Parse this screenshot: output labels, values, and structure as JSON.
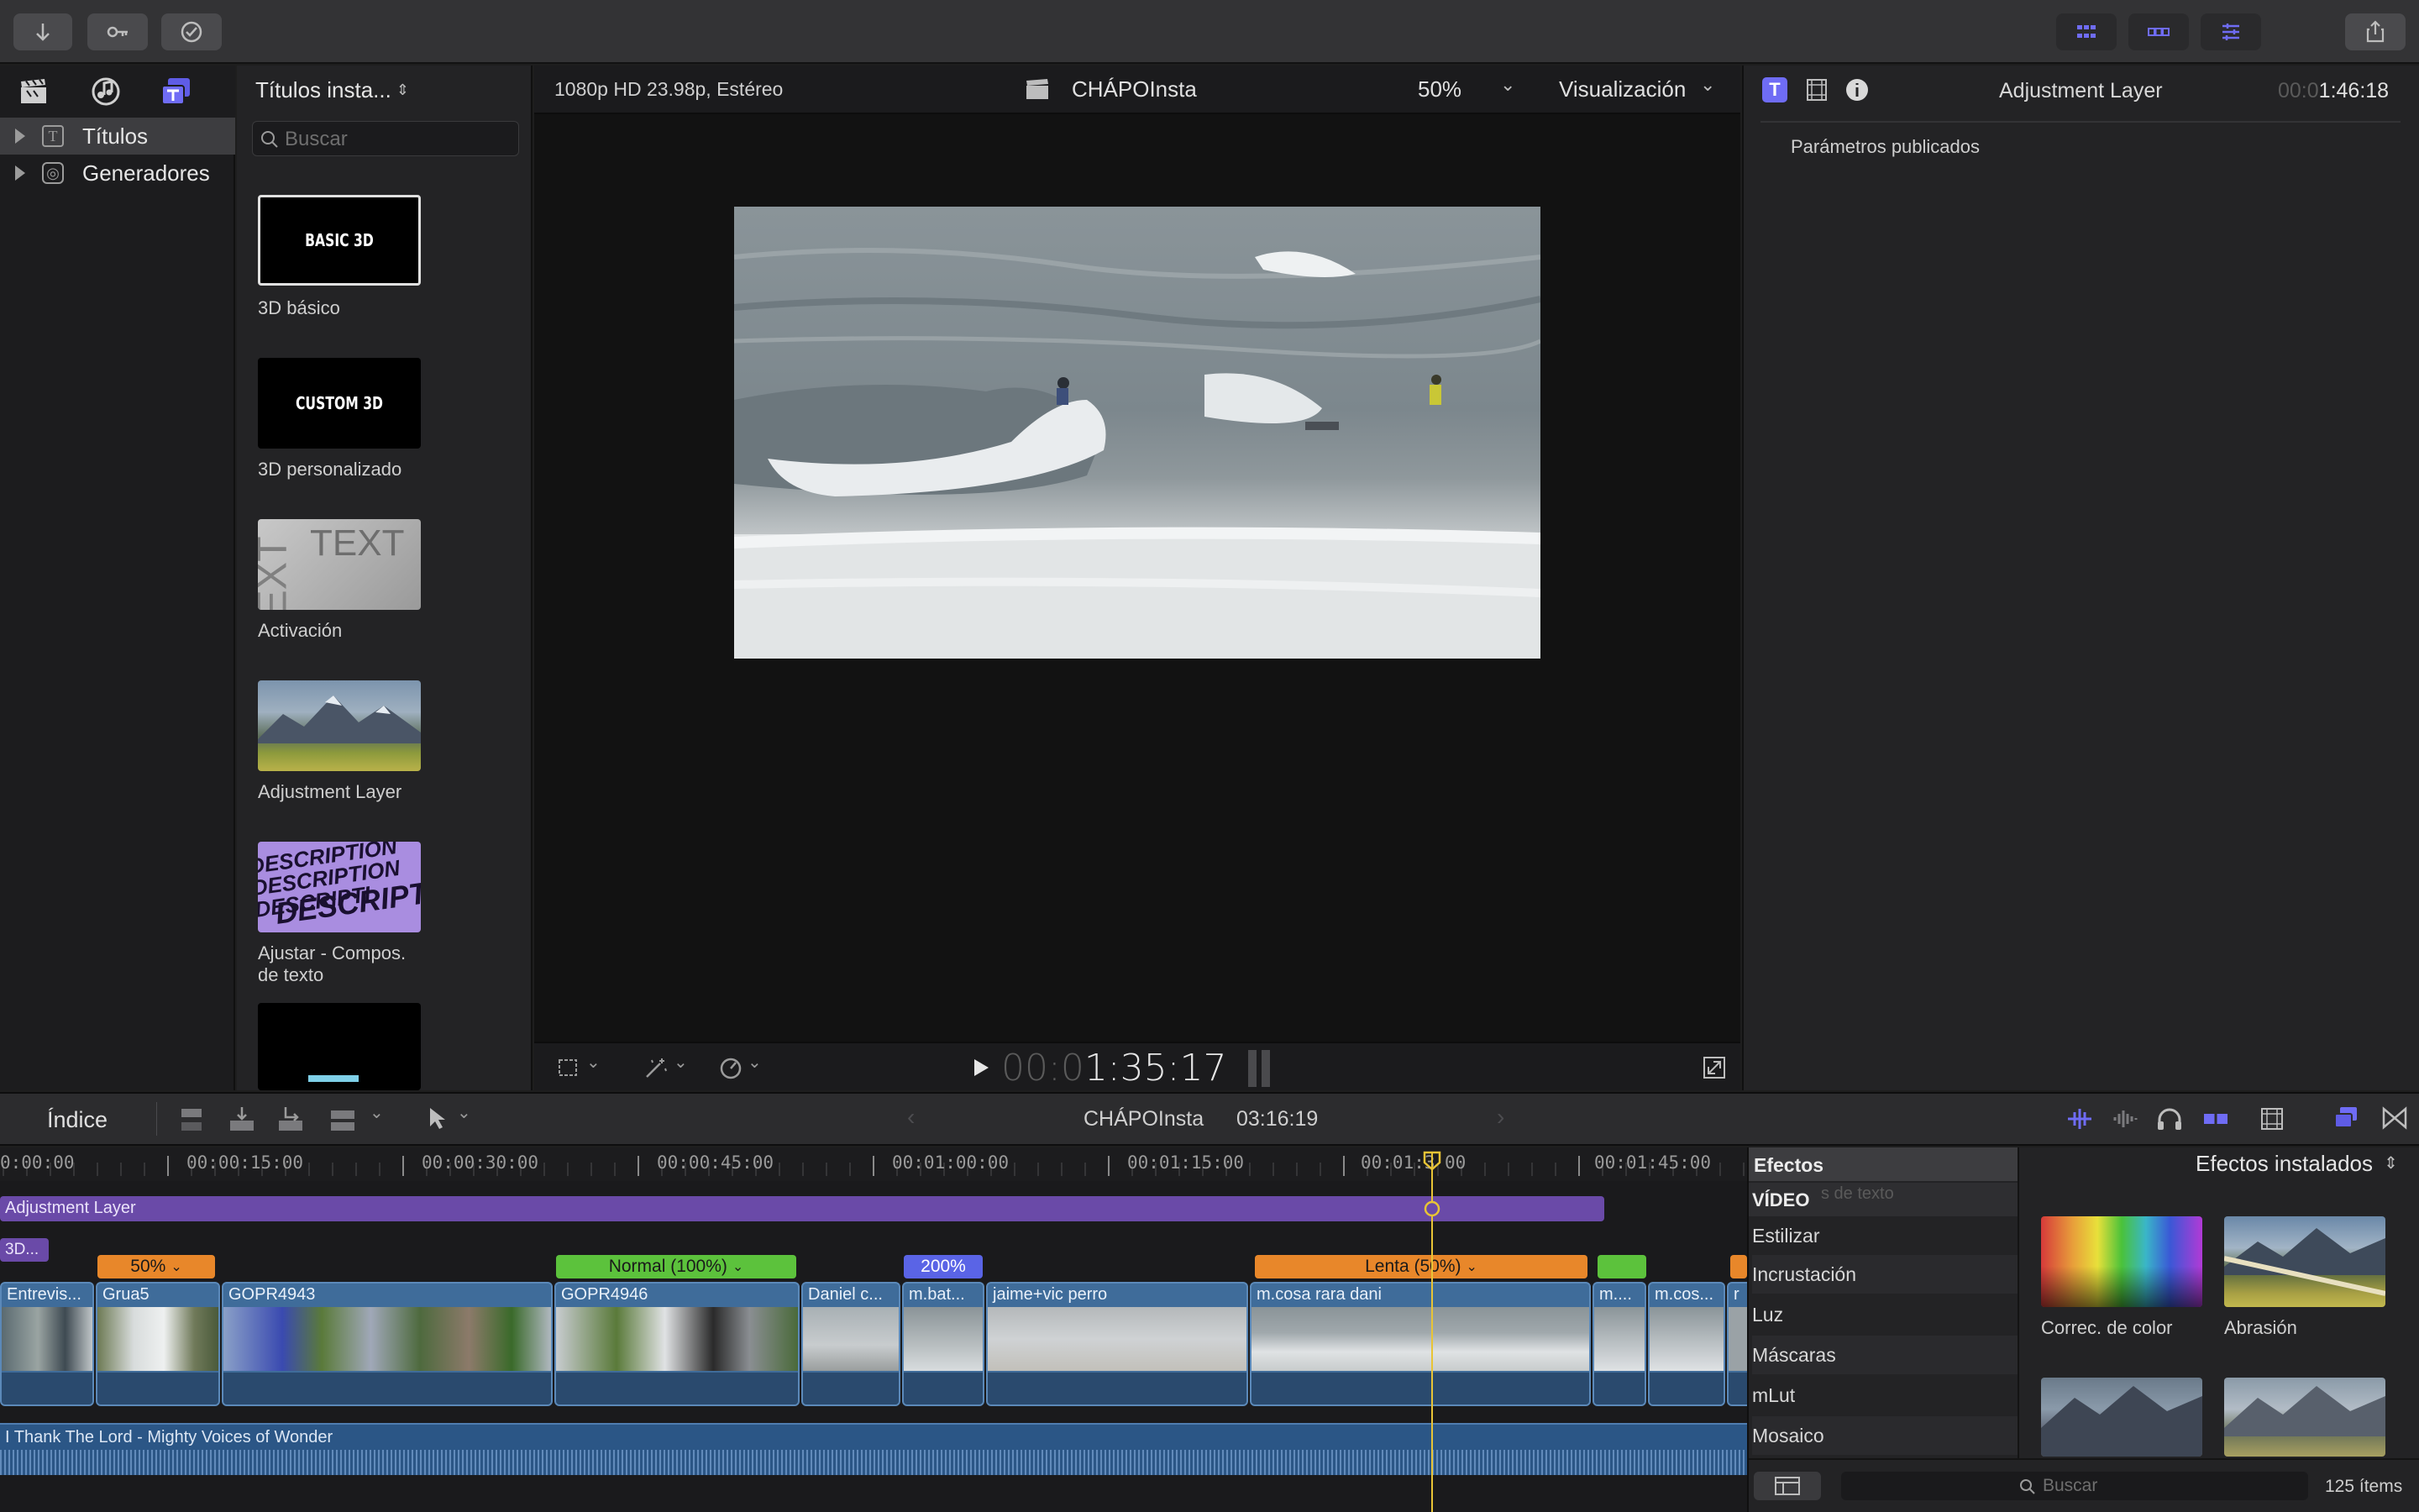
{
  "toolbar": {
    "import_icon": "arrow-down-icon",
    "keywords_icon": "key-icon",
    "background_tasks_icon": "checkmark-circle-icon",
    "right_icons": [
      "browser-grid-icon",
      "timeline-layout-icon",
      "inspector-sliders-icon",
      "share-icon"
    ]
  },
  "browser": {
    "library_tabs": [
      "clapper-icon",
      "music-icon",
      "titles-icon"
    ],
    "dropdown_label": "Títulos insta...",
    "search_placeholder": "Buscar",
    "side_items": [
      {
        "label": "Títulos"
      },
      {
        "label": "Generadores"
      }
    ],
    "items": [
      {
        "label": "3D básico",
        "thumb_text": "BASIC 3D"
      },
      {
        "label": "3D personalizado",
        "thumb_text": "CUSTOM 3D"
      },
      {
        "label": "Activación",
        "thumb_text": "TEXT"
      },
      {
        "label": "Adjustment Layer"
      },
      {
        "label": "Ajustar - Compos. de texto",
        "thumb_text": "DESCRIPTION"
      }
    ]
  },
  "viewer": {
    "format": "1080p HD 23.98p, Estéreo",
    "project_name": "CHÁPOInsta",
    "zoom": "50%",
    "view_menu": "Visualización",
    "timecode_dim": "00:0",
    "timecode": "1:35:17"
  },
  "inspector": {
    "title": "Adjustment Layer",
    "duration_dim": "00:0",
    "duration": "1:46:18",
    "section": "Parámetros publicados"
  },
  "timeline": {
    "index_label": "Índice",
    "project_name": "CHÁPOInsta",
    "duration": "03:16:19",
    "ruler": [
      "0:00:00",
      "00:00:15:00",
      "00:00:30:00",
      "00:00:45:00",
      "00:01:00:00",
      "00:01:15:00",
      "00:01:3",
      "00:01:45:00"
    ],
    "ruler_tail": "00",
    "adjustment_label": "Adjustment Layer",
    "title_chip": "3D...",
    "speed_tags": [
      {
        "label": "50%",
        "color": "#e8872a"
      },
      {
        "label": "Normal (100%)",
        "color": "#5cc23c"
      },
      {
        "label": "200%",
        "color": "#5a64e6"
      },
      {
        "label": "Lenta (50%)",
        "color": "#e8872a"
      }
    ],
    "clips": [
      {
        "name": "Entrevis..."
      },
      {
        "name": "Grua5"
      },
      {
        "name": "GOPR4943"
      },
      {
        "name": "GOPR4946"
      },
      {
        "name": "Daniel c..."
      },
      {
        "name": "m.bat..."
      },
      {
        "name": "jaime+vic perro"
      },
      {
        "name": "m.cosa rara dani"
      },
      {
        "name": "m...."
      },
      {
        "name": "m.cos..."
      },
      {
        "name": "r"
      }
    ],
    "audio_label": "I Thank The Lord - Mighty Voices of Wonder"
  },
  "effects": {
    "header": "Efectos",
    "installed_label": "Efectos instalados",
    "section": "VÍDEO",
    "section_overlay": "s de texto",
    "categories": [
      "Estilizar",
      "Incrustación",
      "Luz",
      "Máscaras",
      "mLut",
      "Mosaico"
    ],
    "items": [
      {
        "label": "Correc. de color"
      },
      {
        "label": "Abrasión"
      }
    ],
    "search_placeholder": "Buscar",
    "count": "125 ítems"
  }
}
